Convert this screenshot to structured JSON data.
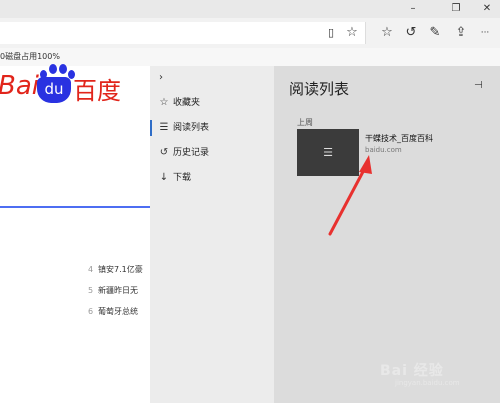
{
  "window": {
    "minimize_icon": "minimize-icon",
    "maximize_icon": "restore-icon",
    "close_icon": "close-icon",
    "minimize_glyph": "–",
    "maximize_glyph": "❐",
    "close_glyph": "✕"
  },
  "toolbar": {
    "icons": [
      {
        "name": "reading-view-icon",
        "glyph": "▯"
      },
      {
        "name": "favorite-star-icon",
        "glyph": "☆"
      },
      {
        "name": "hub-icon",
        "glyph": "☆"
      },
      {
        "name": "history-icon",
        "glyph": "↺"
      },
      {
        "name": "pen-icon",
        "glyph": "✎"
      },
      {
        "name": "share-icon",
        "glyph": "⇪"
      },
      {
        "name": "more-icon",
        "glyph": "···"
      }
    ]
  },
  "favorites_bar": {
    "text": "0磁盘占用100%"
  },
  "page": {
    "logo_ba": "Bai",
    "logo_du": "du",
    "logo_cn": "百度",
    "hot_list": [
      {
        "num": "4",
        "text": "镇安7.1亿豪"
      },
      {
        "num": "5",
        "text": "新疆昨日无"
      },
      {
        "num": "6",
        "text": "葡萄牙总统"
      }
    ]
  },
  "hub_nav": {
    "chevron": "›",
    "items": [
      {
        "icon": "favorites-icon",
        "glyph": "☆",
        "label": "收藏夹"
      },
      {
        "icon": "reading-list-icon",
        "glyph": "☰",
        "label": "阅读列表"
      },
      {
        "icon": "history-icon",
        "glyph": "↺",
        "label": "历史记录"
      },
      {
        "icon": "download-icon",
        "glyph": "↓",
        "label": "下载"
      }
    ]
  },
  "reading_list": {
    "title": "阅读列表",
    "pin_glyph": "⊣",
    "section": "上周",
    "entries": [
      {
        "thumb_glyph": "☰",
        "title": "干蝶技术_百度百科",
        "url": "baidu.com"
      }
    ]
  },
  "watermark": {
    "text": "Bai 经验",
    "sub": "jingyan.baidu.com"
  },
  "colors": {
    "accent": "#2f6dc7",
    "annotation_arrow": "#e8312f",
    "baidu_red": "#e1251b",
    "baidu_blue": "#2932e1"
  }
}
